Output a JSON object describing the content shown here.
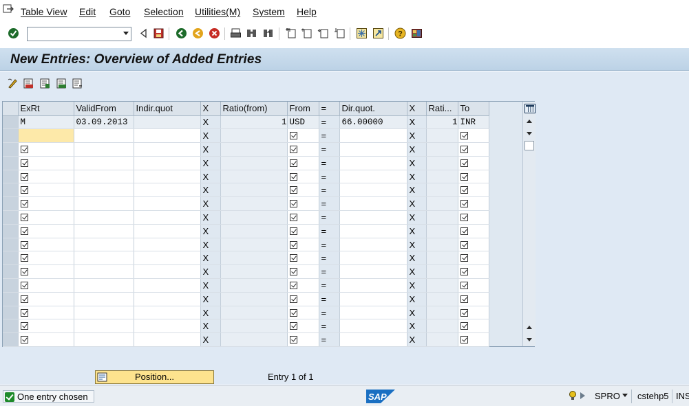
{
  "menu": [
    "Table View",
    "Edit",
    "Goto",
    "Selection",
    "Utilities(M)",
    "System",
    "Help"
  ],
  "toolbar": {
    "command_field_value": "",
    "icons": [
      "enter-icon",
      "back-icon",
      "save-icon",
      "back-green-icon",
      "exit-icon",
      "cancel-icon",
      "print-icon",
      "find-icon",
      "find-next-icon",
      "first-page-icon",
      "prev-page-icon",
      "next-page-icon",
      "last-page-icon",
      "create-session-icon",
      "shortcut-icon",
      "help-icon",
      "layout-icon"
    ]
  },
  "title": "New Entries: Overview of Added Entries",
  "app_toolbar_icons": [
    "change-display-icon",
    "new-entries-icon",
    "copy-as-icon",
    "delete-icon",
    "undo-change-icon"
  ],
  "table": {
    "columns": [
      "ExRt",
      "ValidFrom",
      "Indir.quot",
      "X",
      "Ratio(from)",
      "From",
      "=",
      "Dir.quot.",
      "X",
      "Rati...",
      "To"
    ],
    "rows": [
      {
        "exrt": "M",
        "valid_from": "03.09.2013",
        "indir": "",
        "x1": "X",
        "ratio_from": "1",
        "from": "USD",
        "eq": "=",
        "dir": "66.00000",
        "x2": "X",
        "ratio_to": "1",
        "to": "INR"
      }
    ],
    "empty_row_x": "X",
    "empty_row_eq": "=",
    "empty_row_count": 16
  },
  "position_button": "Position...",
  "entry_text": "Entry 1 of 1",
  "status": {
    "message": "One entry chosen",
    "transaction": "SPRO",
    "server": "cstehp5",
    "mode": "INS"
  },
  "colors": {
    "title_bg": "#c4d7ea",
    "app_bg": "#dfe9f4",
    "focus_cell": "#fde9a9",
    "status_ok": "#1e8a2a"
  }
}
